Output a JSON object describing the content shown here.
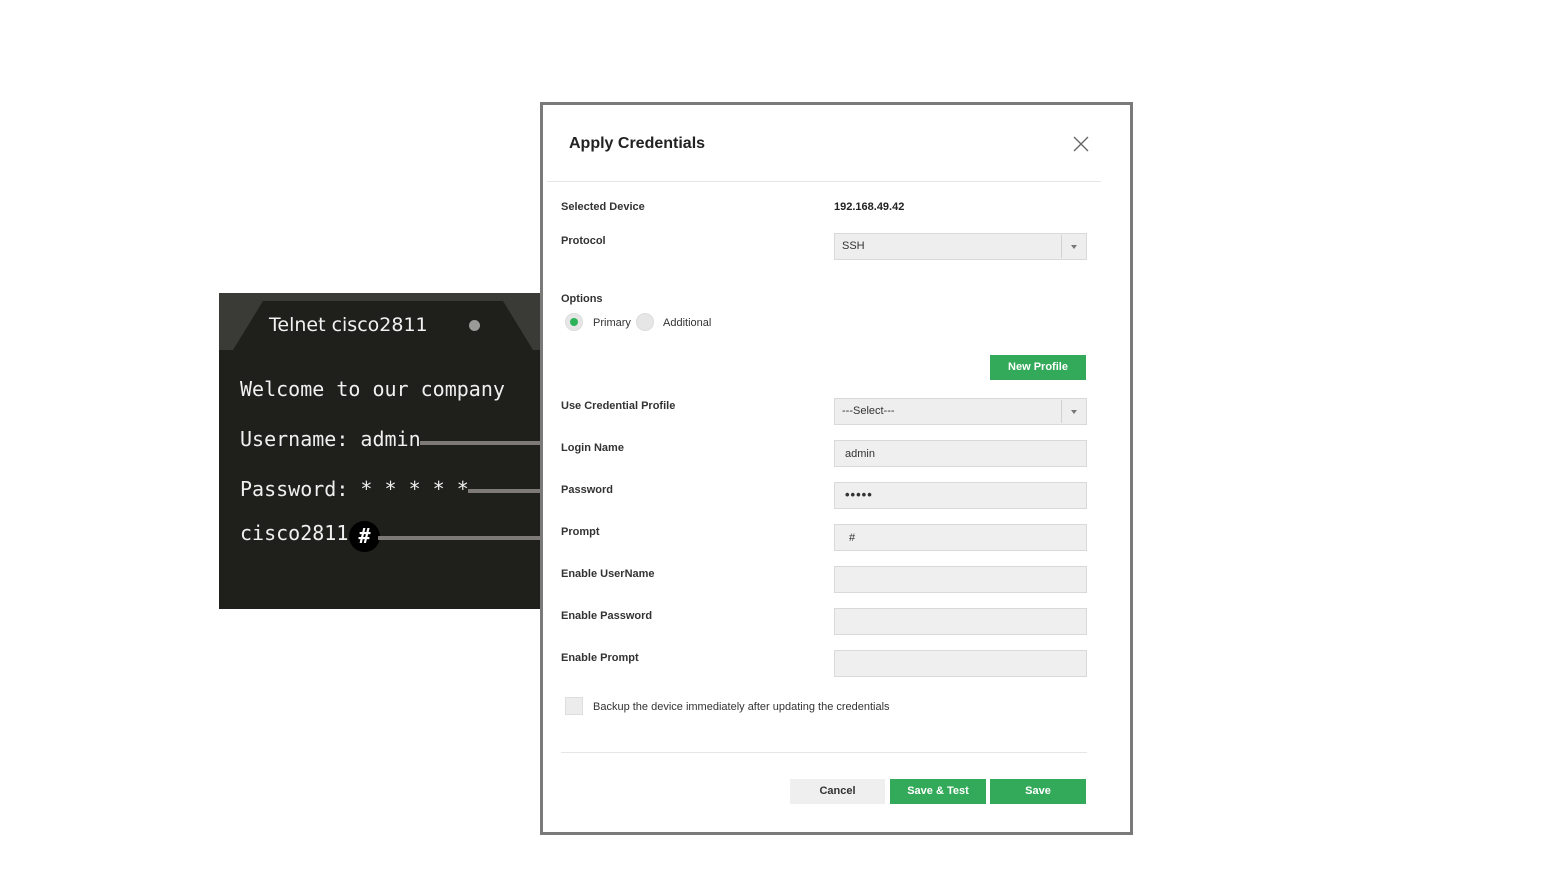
{
  "terminal": {
    "tab_title": "Telnet cisco2811",
    "welcome": "Welcome to our company",
    "username_line": "Username: admin",
    "password_line": "Password: * * * * *",
    "prompt_host": "cisco2811",
    "prompt_symbol": "#"
  },
  "dialog": {
    "title": "Apply Credentials",
    "close_icon": "close-icon",
    "selected_device": {
      "label": "Selected Device",
      "value": "192.168.49.42"
    },
    "protocol": {
      "label": "Protocol",
      "value": "SSH"
    },
    "options": {
      "label": "Options",
      "primary": "Primary",
      "additional": "Additional",
      "selected": "Primary"
    },
    "new_profile_button": "New Profile",
    "credential_profile": {
      "label": "Use Credential Profile",
      "value": "---Select---"
    },
    "login_name": {
      "label": "Login Name",
      "value": "admin"
    },
    "password": {
      "label": "Password",
      "value": "•••••"
    },
    "prompt": {
      "label": "Prompt",
      "value": "#"
    },
    "enable_username": {
      "label": "Enable UserName",
      "value": ""
    },
    "enable_password": {
      "label": "Enable Password",
      "value": ""
    },
    "enable_prompt": {
      "label": "Enable Prompt",
      "value": ""
    },
    "backup_checkbox": {
      "label": "Backup the device immediately after updating the credentials",
      "checked": false
    },
    "buttons": {
      "cancel": "Cancel",
      "save_test": "Save & Test",
      "save": "Save"
    }
  },
  "colors": {
    "accent_green": "#33a95a",
    "terminal_bg": "#1f201c",
    "arrow": "#7e7a78",
    "dialog_border": "#7a7a7a"
  }
}
